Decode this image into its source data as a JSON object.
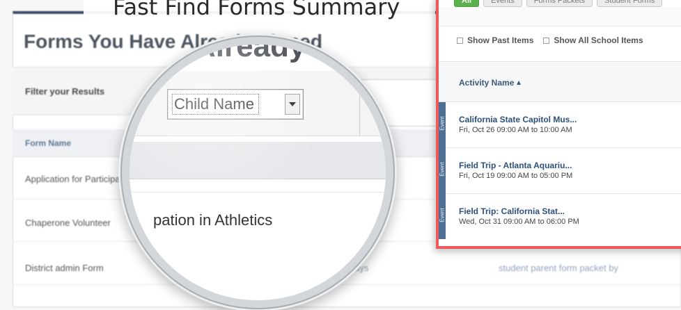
{
  "slide": {
    "title": "Fast Find Forms Summary"
  },
  "background": {
    "section_title": "Forms You Have Already Signed",
    "filter_label": "Filter your Results",
    "column_header": "Form Name",
    "rows": [
      {
        "form": "Application for Participation in Athletics",
        "extra": ""
      },
      {
        "form": "Chaperone Volunteer",
        "extra": ""
      },
      {
        "form": "District admin Form",
        "extra": "days",
        "packet": "student parent form packet by"
      }
    ]
  },
  "magnifier": {
    "title": "Already Signed",
    "select_value": "Child Name",
    "row_text": "pation in Athletics"
  },
  "panel": {
    "tabs": [
      {
        "label": "All",
        "active": true
      },
      {
        "label": "Events",
        "active": false
      },
      {
        "label": "Forms Packets",
        "active": false
      },
      {
        "label": "Student Forms",
        "active": false
      }
    ],
    "checkboxes": [
      {
        "label": "Show Past Items",
        "checked": false
      },
      {
        "label": "Show All School Items",
        "checked": false
      }
    ],
    "column_header": "Activity Name",
    "event_tag": "Event",
    "events": [
      {
        "name": "California State Capitol Mus...",
        "time": "Fri, Oct 26 09:00 AM to 10:00 AM"
      },
      {
        "name": "Field Trip - Atlanta Aquariu...",
        "time": "Fri, Oct 19 09:00 AM to 05:00 PM"
      },
      {
        "name": "Field Trip: California Stat...",
        "time": "Wed, Oct 31 09:00 AM to 06:00 PM"
      }
    ],
    "colors": {
      "border": "#ee5a5a",
      "tab_active": "#5bb14b",
      "event_tag": "#4d6f93",
      "link": "#2c4f7c"
    }
  }
}
